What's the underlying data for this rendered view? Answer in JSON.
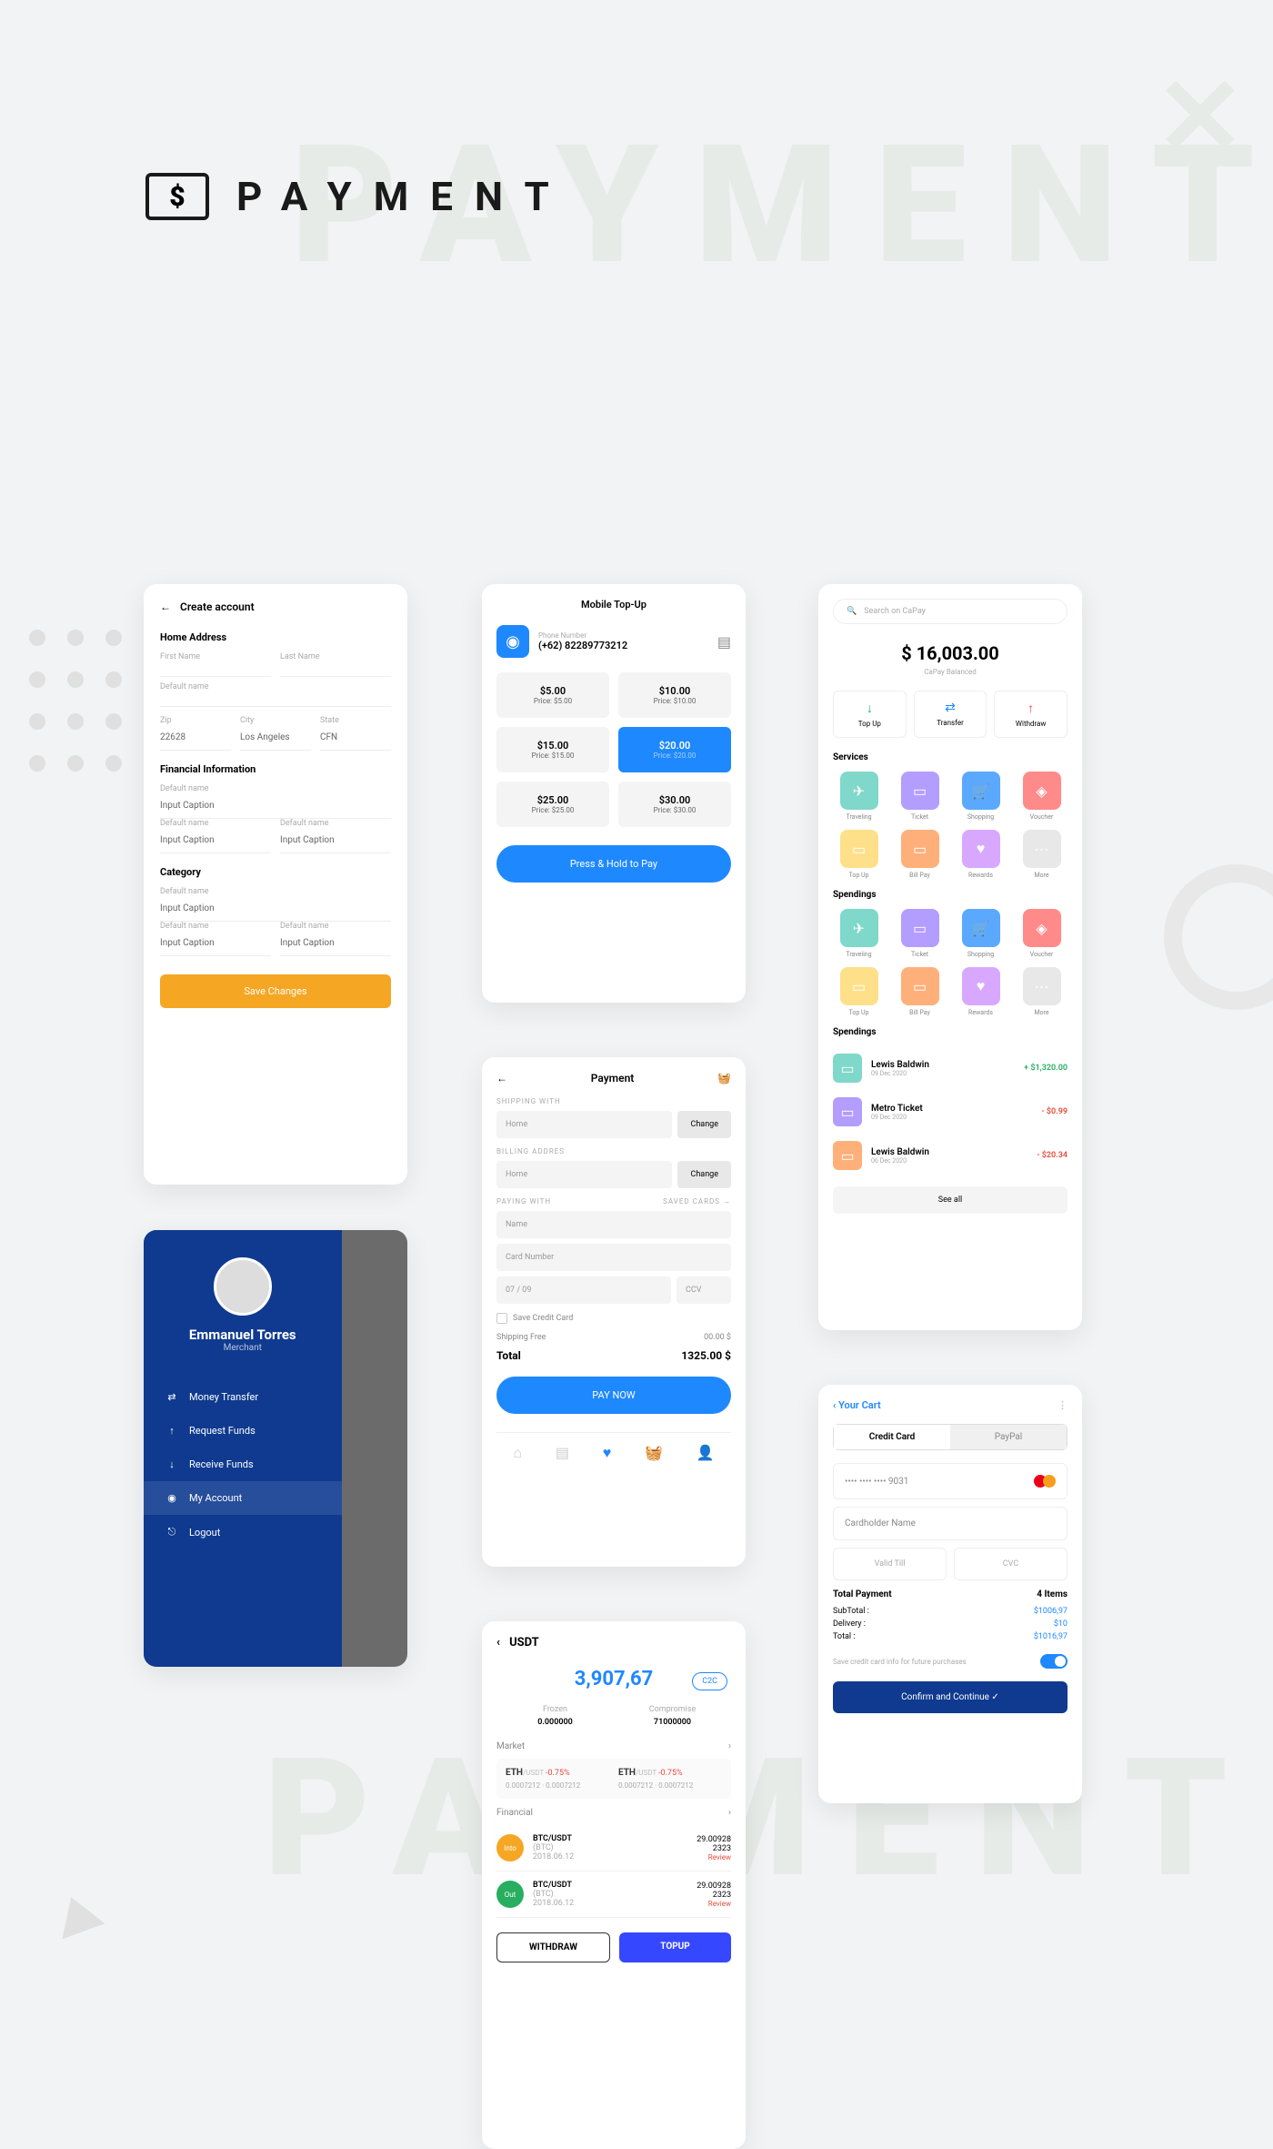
{
  "header": {
    "title": "PAYMENT",
    "bg_text": "PAYMENT"
  },
  "s1": {
    "title": "Create account",
    "sect1": "Home Address",
    "first_name_lbl": "First Name",
    "last_name_lbl": "Last Name",
    "default_lbl": "Default name",
    "zip_lbl": "Zip",
    "zip": "22628",
    "city_lbl": "City",
    "city": "Los Angeles",
    "state_lbl": "State",
    "state": "CFN",
    "sect2": "Financial Information",
    "caption": "Input Caption",
    "sect3": "Category",
    "save": "Save Changes"
  },
  "s2": {
    "name": "Emmanuel Torres",
    "role": "Merchant",
    "items": [
      {
        "icon": "⇄",
        "label": "Money Transfer"
      },
      {
        "icon": "↑",
        "label": "Request Funds"
      },
      {
        "icon": "↓",
        "label": "Receive Funds"
      },
      {
        "icon": "◉",
        "label": "My Account"
      },
      {
        "icon": "⎋",
        "label": "Logout"
      }
    ]
  },
  "s3": {
    "title": "Mobile Top-Up",
    "phone_lbl": "Phone Number",
    "phone": "(+62) 82289773212",
    "amounts": [
      {
        "v": "$5.00",
        "p": "Price: $5.00"
      },
      {
        "v": "$10.00",
        "p": "Price: $10.00"
      },
      {
        "v": "$15.00",
        "p": "Price: $15.00"
      },
      {
        "v": "$20.00",
        "p": "Price: $20.00"
      },
      {
        "v": "$25.00",
        "p": "Price: $25.00"
      },
      {
        "v": "$30.00",
        "p": "Price: $30.00"
      }
    ],
    "pay": "Press & Hold to Pay"
  },
  "s4": {
    "title": "Payment",
    "ship_lbl": "SHIPPING WITH",
    "bill_lbl": "BILLING ADDRES",
    "pay_lbl": "PAYING WITH",
    "saved": "SAVED CARDS →",
    "home": "Home",
    "change": "Change",
    "name": "Name",
    "card": "Card Number",
    "exp": "07  /  09",
    "ccv": "CCV",
    "save": "Save Credit Card",
    "ship_free": "Shipping Free",
    "ship_amt": "00.00 $",
    "total_lbl": "Total",
    "total": "1325.00 $",
    "paynow": "PAY NOW"
  },
  "s5": {
    "title": "USDT",
    "balance": "3,907,67",
    "c2c": "C2C",
    "frozen_lbl": "Frozen",
    "frozen": "0.000000",
    "comp_lbl": "Compromise",
    "comp": "71000000",
    "market_lbl": "Market",
    "markets": [
      {
        "pair": "ETH/USDT",
        "rate": "-0.75%",
        "lo": "0.0007212",
        "hi": "0.0007212"
      },
      {
        "pair": "ETH/USDT",
        "rate": "-0.75%",
        "lo": "0.0007212",
        "hi": "0.0007212"
      }
    ],
    "fin_lbl": "Financial",
    "txs": [
      {
        "dir": "Into",
        "pair": "BTC/USDT",
        "sym": "(BTC)",
        "date": "2018.06.12",
        "amt": "29.00928",
        "qty": "2323",
        "status": "Review"
      },
      {
        "dir": "Out",
        "pair": "BTC/USDT",
        "sym": "(BTC)",
        "date": "2018.06.12",
        "amt": "29.00928",
        "qty": "2323",
        "status": "Review"
      }
    ],
    "withdraw": "WITHDRAW",
    "topup": "TOPUP"
  },
  "s6": {
    "search": "Search on CaPay",
    "balance": "$ 16,003.00",
    "bal_lbl": "CaPay Balanced",
    "actions": [
      {
        "icon": "↓",
        "label": "Top Up",
        "cls": "gu"
      },
      {
        "icon": "⇄",
        "label": "Transfer",
        "cls": "bu"
      },
      {
        "icon": "↑",
        "label": "Withdraw",
        "cls": "ru"
      }
    ],
    "services_lbl": "Services",
    "services": [
      {
        "icon": "✈",
        "label": "Traveling",
        "bg": "#7fd8c9"
      },
      {
        "icon": "▭",
        "label": "Ticket",
        "bg": "#b39dff"
      },
      {
        "icon": "🛒",
        "label": "Shopping",
        "bg": "#5aa9ff"
      },
      {
        "icon": "◈",
        "label": "Voucher",
        "bg": "#ff8a8a"
      },
      {
        "icon": "▭",
        "label": "Top Up",
        "bg": "#ffe08a"
      },
      {
        "icon": "▭",
        "label": "Bill Pay",
        "bg": "#ffb07a"
      },
      {
        "icon": "♥",
        "label": "Rewards",
        "bg": "#d8a8ff"
      },
      {
        "icon": "⋯",
        "label": "More",
        "bg": "#e8e8e8"
      }
    ],
    "spend_lbl": "Spendings",
    "txs": [
      {
        "name": "Lewis Baldwin",
        "date": "09 Dec 2020",
        "amt": "+ $1,320.00",
        "cls": "pos",
        "bg": "#7fd8c9"
      },
      {
        "name": "Metro Ticket",
        "date": "09 Dec 2020",
        "amt": "- $0.99",
        "cls": "neg",
        "bg": "#b39dff"
      },
      {
        "name": "Lewis Baldwin",
        "date": "06 Dec 2020",
        "amt": "- $20.34",
        "cls": "neg",
        "bg": "#ffb07a"
      }
    ],
    "see": "See all"
  },
  "s7": {
    "title": "Your Cart",
    "tab1": "Credit Card",
    "tab2": "PayPal",
    "card": "•••• •••• •••• 9031",
    "holder": "Cardholder Name",
    "valid": "Valid Till",
    "cvc": "CVC",
    "tp_lbl": "Total Payment",
    "items": "4 Items",
    "sub_lbl": "SubTotal :",
    "sub": "$1006,97",
    "del_lbl": "Delivery :",
    "del": "$10",
    "tot_lbl": "Total :",
    "tot": "$1016,97",
    "save": "Save credit card info for future purchases",
    "confirm": "Confirm and Continue  ✓"
  }
}
